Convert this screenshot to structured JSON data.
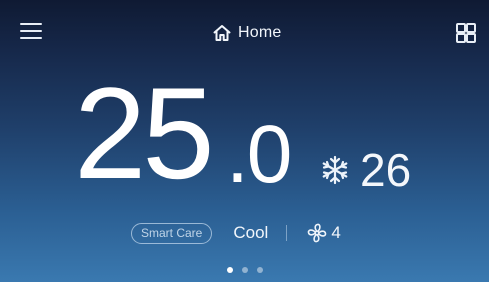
{
  "header": {
    "menu_icon": "hamburger-menu-icon",
    "home_icon": "home-icon",
    "title": "Home",
    "grid_icon": "grid-apps-icon"
  },
  "thermostat": {
    "current_integer": "25",
    "current_decimal": ".0",
    "current_value": 25.0,
    "mode_icon": "snowflake-icon",
    "set_temperature": "26"
  },
  "status": {
    "smart_care_label": "Smart Care",
    "mode_label": "Cool",
    "fan_icon": "fan-icon",
    "fan_speed": "4"
  },
  "pagination": {
    "total": 3,
    "active_index": 0
  },
  "colors": {
    "background_top": "#0f1a33",
    "background_bottom": "#3a79b0",
    "text": "#ffffff"
  }
}
